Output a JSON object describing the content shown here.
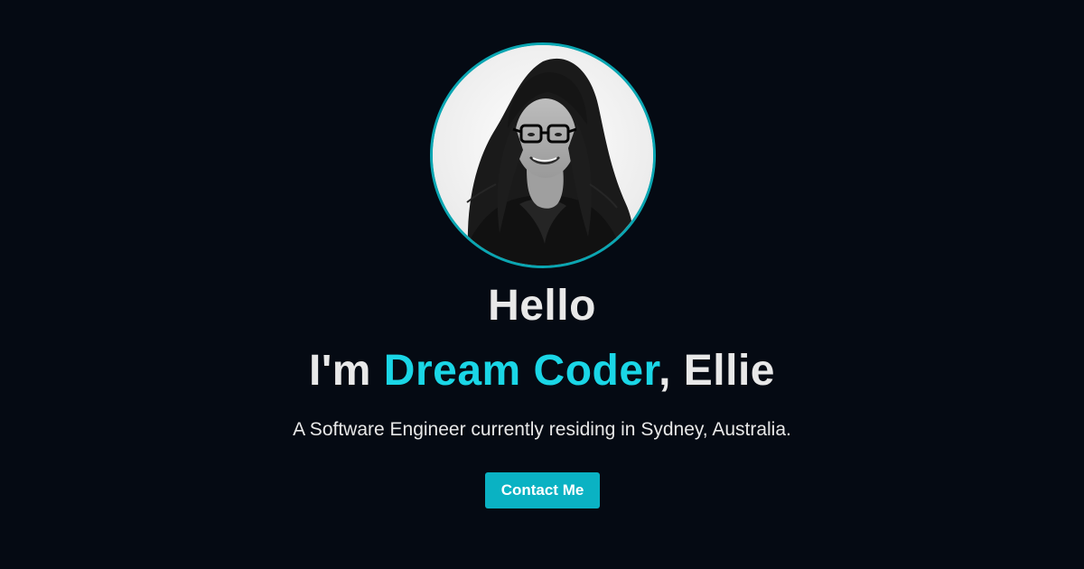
{
  "hero": {
    "avatar_alt": "portrait",
    "greeting": "Hello",
    "headline_prefix": "I'm ",
    "headline_highlight": "Dream Coder",
    "headline_suffix": ", Ellie",
    "description": "A Software Engineer currently residing in Sydney, Australia.",
    "contact_label": "Contact Me"
  },
  "colors": {
    "background": "#050a13",
    "accent": "#1ad6e6",
    "button": "#0ab2c3",
    "avatar_ring": "#0aa6b2",
    "text": "#e8e8e8"
  }
}
